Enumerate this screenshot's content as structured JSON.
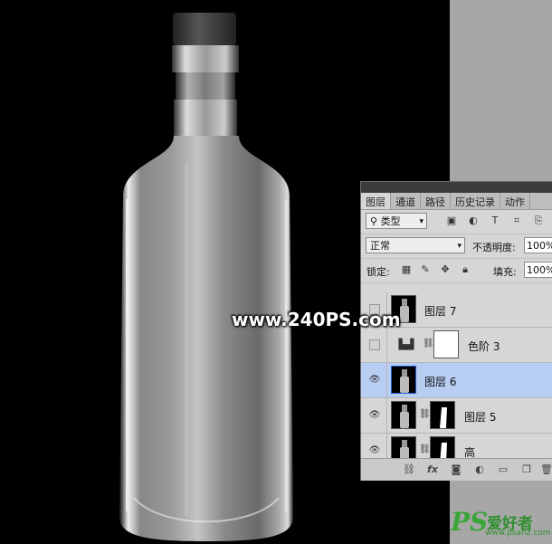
{
  "watermark": "www.240PS.com",
  "logo": {
    "ps": "PS",
    "cn": "爱好者",
    "url": "www.psahz.com"
  },
  "panel": {
    "tabs": [
      "图层",
      "通道",
      "路径",
      "历史记录",
      "动作"
    ],
    "filter_kind": "类型",
    "blend_mode": "正常",
    "opacity_label": "不透明度:",
    "opacity_value": "100%",
    "lock_label": "锁定:",
    "fill_label": "填充:",
    "fill_value": "100%",
    "layers": [
      {
        "name": "图层 7",
        "visible": false,
        "selected": false
      },
      {
        "name": "色阶 3",
        "visible": false,
        "selected": false
      },
      {
        "name": "图层 6",
        "visible": true,
        "selected": true
      },
      {
        "name": "图层 5",
        "visible": true,
        "selected": false
      },
      {
        "name": "高",
        "visible": true,
        "selected": false
      }
    ]
  }
}
